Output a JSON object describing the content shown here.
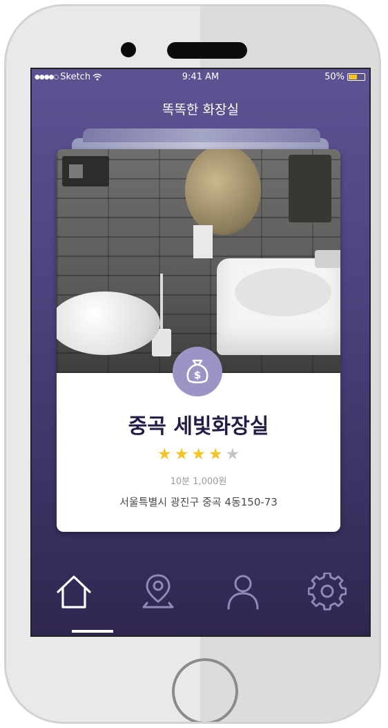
{
  "status_bar": {
    "carrier": "Sketch",
    "time": "9:41 AM",
    "battery": "50%",
    "battery_color": "#f5c22b"
  },
  "header": {
    "title": "똑똑한 화장실"
  },
  "card": {
    "name": "중곡 세빛화장실",
    "rating": 4,
    "rating_max": 5,
    "price": "10분 1,000원",
    "address": "서울특별시 광진구 중곡 4동150-73",
    "badge_icon": "money-bag-icon"
  },
  "tabs": [
    {
      "name": "home",
      "icon": "home-icon",
      "active": true
    },
    {
      "name": "map",
      "icon": "map-pin-icon",
      "active": false
    },
    {
      "name": "profile",
      "icon": "user-icon",
      "active": false
    },
    {
      "name": "settings",
      "icon": "gear-icon",
      "active": false
    }
  ],
  "colors": {
    "screen_top": "#5d5393",
    "screen_bottom": "#2f2650",
    "badge": "#9b95c5",
    "star": "#f6c325",
    "title_text": "#231c44"
  }
}
